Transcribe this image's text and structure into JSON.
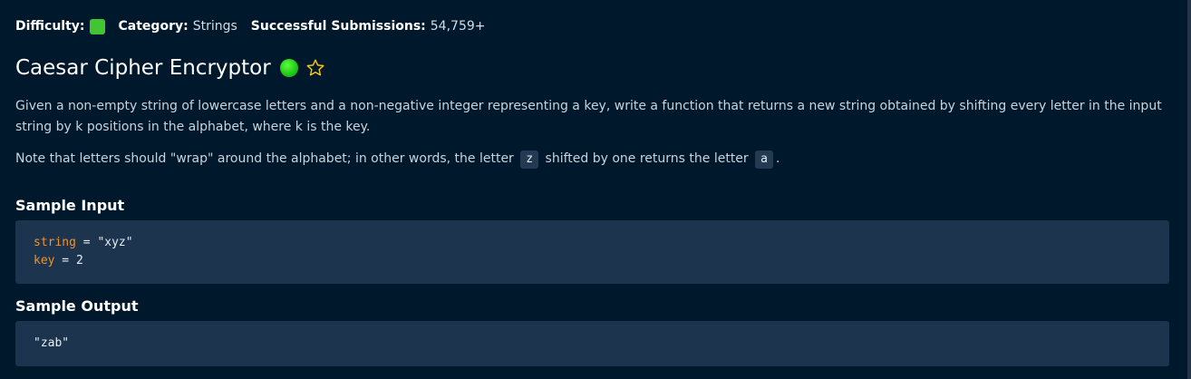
{
  "meta": {
    "difficulty_label": "Difficulty:",
    "difficulty_color": "#41c534",
    "category_label": "Category:",
    "category_value": "Strings",
    "submissions_label": "Successful Submissions:",
    "submissions_value": "54,759+"
  },
  "problem": {
    "title": "Caesar Cipher Encryptor",
    "status_icon": "green-check-dot-icon",
    "favorite_icon": "star-outline-icon",
    "description": "Given a non-empty string of lowercase letters and a non-negative integer representing a key, write a function that returns a new string obtained by shifting every letter in the input string by k positions in the alphabet, where k is the key.",
    "note_part1": "Note that letters should \"wrap\" around the alphabet; in other words, the letter",
    "note_code1": "z",
    "note_part2": "shifted by one returns the letter",
    "note_code2": "a",
    "note_part3": "."
  },
  "sample_input": {
    "title": "Sample Input",
    "lines": [
      {
        "var": "string",
        "rest": " = \"xyz\""
      },
      {
        "var": "key",
        "rest": " = 2"
      }
    ]
  },
  "sample_output": {
    "title": "Sample Output",
    "value": "\"zab\""
  },
  "colors": {
    "background": "#00182b",
    "code_block": "#1c344e",
    "keyword": "#f0932b",
    "star": "#f5c518"
  }
}
